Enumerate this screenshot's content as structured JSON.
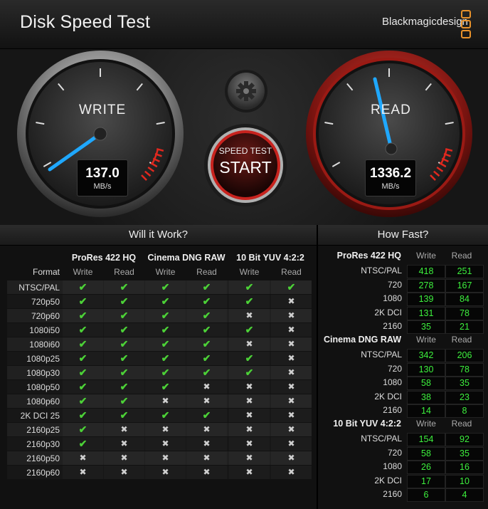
{
  "window": {
    "close_glyph": "×"
  },
  "header": {
    "title": "Disk Speed Test",
    "brand": "Blackmagicdesign"
  },
  "gauges": {
    "write": {
      "label": "WRITE",
      "value": "137.0",
      "unit": "MB/s"
    },
    "read": {
      "label": "READ",
      "value": "1336.2",
      "unit": "MB/s"
    }
  },
  "start_button": {
    "top": "SPEED TEST",
    "main": "START"
  },
  "will_it_work": {
    "title": "Will it Work?",
    "format_header": "Format",
    "codecs": [
      "ProRes 422 HQ",
      "Cinema DNG RAW",
      "10 Bit YUV 4:2:2"
    ],
    "sub_headers": [
      "Write",
      "Read",
      "Write",
      "Read",
      "Write",
      "Read"
    ],
    "rows": [
      {
        "format": "NTSC/PAL",
        "cells": [
          1,
          1,
          1,
          1,
          1,
          1
        ]
      },
      {
        "format": "720p50",
        "cells": [
          1,
          1,
          1,
          1,
          1,
          0
        ]
      },
      {
        "format": "720p60",
        "cells": [
          1,
          1,
          1,
          1,
          0,
          0
        ]
      },
      {
        "format": "1080i50",
        "cells": [
          1,
          1,
          1,
          1,
          1,
          0
        ]
      },
      {
        "format": "1080i60",
        "cells": [
          1,
          1,
          1,
          1,
          0,
          0
        ]
      },
      {
        "format": "1080p25",
        "cells": [
          1,
          1,
          1,
          1,
          1,
          0
        ]
      },
      {
        "format": "1080p30",
        "cells": [
          1,
          1,
          1,
          1,
          1,
          0
        ]
      },
      {
        "format": "1080p50",
        "cells": [
          1,
          1,
          1,
          0,
          0,
          0
        ]
      },
      {
        "format": "1080p60",
        "cells": [
          1,
          1,
          0,
          0,
          0,
          0
        ]
      },
      {
        "format": "2K DCI 25",
        "cells": [
          1,
          1,
          1,
          1,
          0,
          0
        ]
      },
      {
        "format": "2160p25",
        "cells": [
          1,
          0,
          0,
          0,
          0,
          0
        ]
      },
      {
        "format": "2160p30",
        "cells": [
          1,
          0,
          0,
          0,
          0,
          0
        ]
      },
      {
        "format": "2160p50",
        "cells": [
          0,
          0,
          0,
          0,
          0,
          0
        ]
      },
      {
        "format": "2160p60",
        "cells": [
          0,
          0,
          0,
          0,
          0,
          0
        ]
      }
    ],
    "check_glyph": "✔",
    "cross_glyph": "✖"
  },
  "how_fast": {
    "title": "How Fast?",
    "sub_headers": [
      "Write",
      "Read"
    ],
    "groups": [
      {
        "name": "ProRes 422 HQ",
        "rows": [
          {
            "label": "NTSC/PAL",
            "write": "418",
            "read": "251"
          },
          {
            "label": "720",
            "write": "278",
            "read": "167"
          },
          {
            "label": "1080",
            "write": "139",
            "read": "84"
          },
          {
            "label": "2K DCI",
            "write": "131",
            "read": "78"
          },
          {
            "label": "2160",
            "write": "35",
            "read": "21"
          }
        ]
      },
      {
        "name": "Cinema DNG RAW",
        "rows": [
          {
            "label": "NTSC/PAL",
            "write": "342",
            "read": "206"
          },
          {
            "label": "720",
            "write": "130",
            "read": "78"
          },
          {
            "label": "1080",
            "write": "58",
            "read": "35"
          },
          {
            "label": "2K DCI",
            "write": "38",
            "read": "23"
          },
          {
            "label": "2160",
            "write": "14",
            "read": "8"
          }
        ]
      },
      {
        "name": "10 Bit YUV 4:2:2",
        "rows": [
          {
            "label": "NTSC/PAL",
            "write": "154",
            "read": "92"
          },
          {
            "label": "720",
            "write": "58",
            "read": "35"
          },
          {
            "label": "1080",
            "write": "26",
            "read": "16"
          },
          {
            "label": "2K DCI",
            "write": "17",
            "read": "10"
          },
          {
            "label": "2160",
            "write": "6",
            "read": "4"
          }
        ]
      }
    ]
  },
  "colors": {
    "accent": "#00a8ff",
    "check": "#4cd137",
    "value": "#3df03d",
    "danger": "#c8231e",
    "brand": "#e8922b"
  }
}
